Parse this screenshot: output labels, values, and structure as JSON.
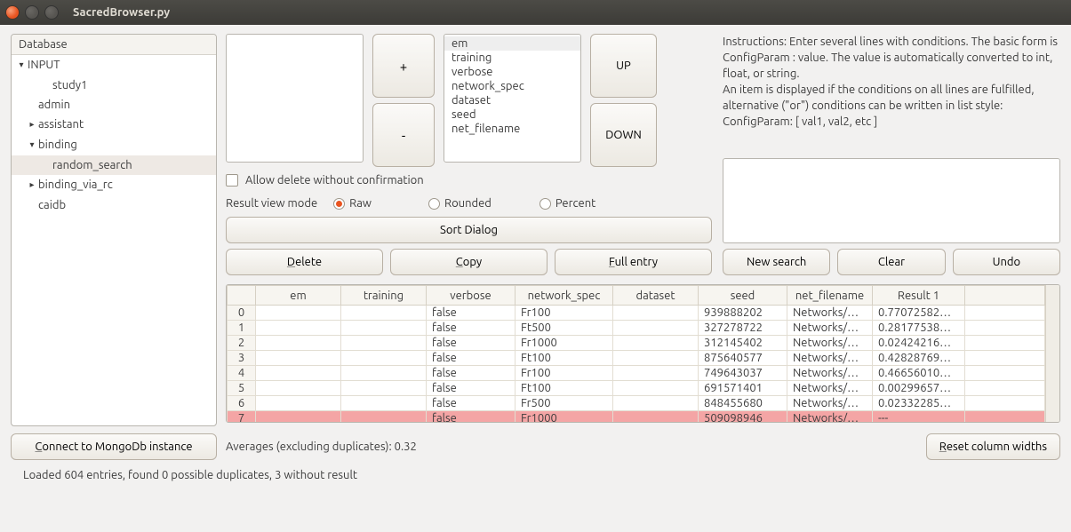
{
  "window": {
    "title": "SacredBrowser.py"
  },
  "database": {
    "header": "Database",
    "tree": [
      {
        "label": "INPUT",
        "depth": 0,
        "caret": "▾"
      },
      {
        "label": "study1",
        "depth": 2
      },
      {
        "label": "admin",
        "depth": 1
      },
      {
        "label": "assistant",
        "depth": 1,
        "caret": "▸"
      },
      {
        "label": "binding",
        "depth": 1,
        "caret": "▾"
      },
      {
        "label": "random_search",
        "depth": 2,
        "selected": true
      },
      {
        "label": "binding_via_rc",
        "depth": 1,
        "caret": "▸"
      },
      {
        "label": "caidb",
        "depth": 1
      }
    ]
  },
  "buttons": {
    "connect": "Connect to MongoDb instance",
    "plus": "+",
    "minus": "-",
    "up": "UP",
    "down": "DOWN",
    "sort": "Sort Dialog",
    "delete": "Delete",
    "copy": "Copy",
    "full_entry": "Full entry",
    "new_search": "New search",
    "clear": "Clear",
    "undo": "Undo",
    "reset_widths": "Reset column widths"
  },
  "columns_list": {
    "items": [
      "em",
      "training",
      "verbose",
      "network_spec",
      "dataset",
      "seed",
      "net_filename"
    ],
    "selected": 0
  },
  "checkbox": {
    "allow_delete": "Allow delete without confirmation"
  },
  "mode": {
    "label": "Result view mode",
    "options": [
      "Raw",
      "Rounded",
      "Percent"
    ],
    "selected": 0
  },
  "instructions": {
    "l1": "Instructions: Enter several lines with conditions. The basic form is",
    "l2": "ConfigParam : value. The value is automatically converted to int, float, or string.",
    "l3": "An item is displayed if the conditions on all lines are fulfilled,",
    "l4": "alternative (\"or\") conditions can be written in list style:",
    "l5": "ConfigParam: [ val1, val2, etc ]"
  },
  "table": {
    "headers": [
      "",
      "em",
      "training",
      "verbose",
      "network_spec",
      "dataset",
      "seed",
      "net_filename",
      "Result 1"
    ],
    "rows": [
      {
        "i": "0",
        "em": "",
        "training": "",
        "verbose": "false",
        "network_spec": "Fr100",
        "dataset": "",
        "seed": "939888202",
        "net_filename": "Networks/…",
        "result": "0.77072582…"
      },
      {
        "i": "1",
        "em": "",
        "training": "",
        "verbose": "false",
        "network_spec": "Ft500",
        "dataset": "",
        "seed": "327278722",
        "net_filename": "Networks/…",
        "result": "0.28177538…"
      },
      {
        "i": "2",
        "em": "",
        "training": "",
        "verbose": "false",
        "network_spec": "Fr1000",
        "dataset": "",
        "seed": "312145402",
        "net_filename": "Networks/…",
        "result": "0.02424216…"
      },
      {
        "i": "3",
        "em": "",
        "training": "",
        "verbose": "false",
        "network_spec": "Ft100",
        "dataset": "",
        "seed": "875640577",
        "net_filename": "Networks/…",
        "result": "0.42828769…"
      },
      {
        "i": "4",
        "em": "",
        "training": "",
        "verbose": "false",
        "network_spec": "Fr100",
        "dataset": "",
        "seed": "749643037",
        "net_filename": "Networks/…",
        "result": "0.46656010…"
      },
      {
        "i": "5",
        "em": "",
        "training": "",
        "verbose": "false",
        "network_spec": "Ft100",
        "dataset": "",
        "seed": "691571401",
        "net_filename": "Networks/…",
        "result": "0.00299657…"
      },
      {
        "i": "6",
        "em": "",
        "training": "",
        "verbose": "false",
        "network_spec": "Fr500",
        "dataset": "",
        "seed": "848455680",
        "net_filename": "Networks/…",
        "result": "0.02332285…"
      },
      {
        "i": "7",
        "em": "",
        "training": "",
        "verbose": "false",
        "network_spec": "Fr1000",
        "dataset": "",
        "seed": "509098946",
        "net_filename": "Networks/…",
        "result": "---",
        "hl": true
      }
    ]
  },
  "averages": "Averages (excluding duplicates): 0.32",
  "status": "Loaded 604 entries, found 0 possible duplicates, 3 without result"
}
